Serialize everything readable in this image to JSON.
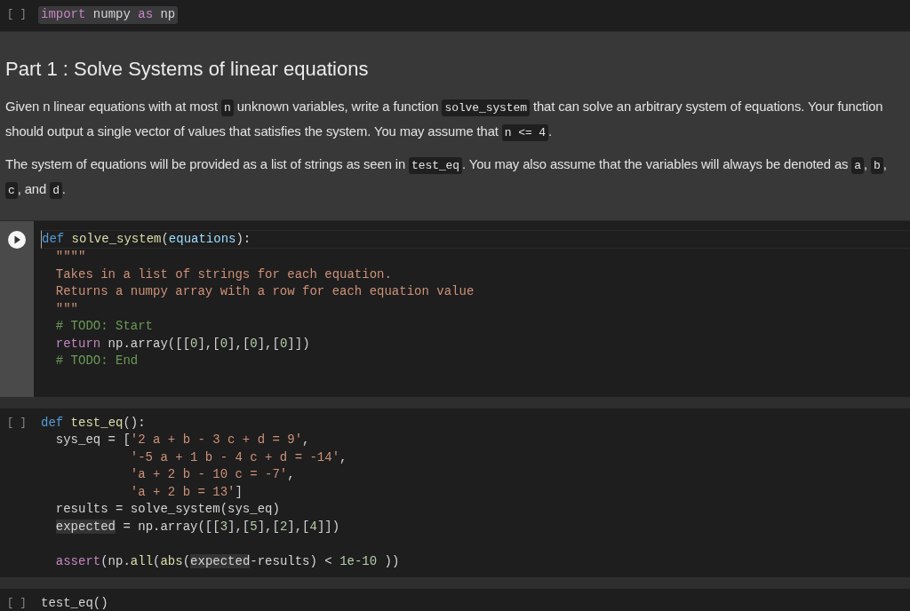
{
  "cells": [
    {
      "kind": "code",
      "prompt": "[ ]",
      "selected": false,
      "lines": [
        {
          "highlighted": true,
          "tokens": [
            {
              "t": "import",
              "kind": "kw2"
            },
            {
              "t": " numpy ",
              "kind": "plain"
            },
            {
              "t": "as",
              "kind": "kw2"
            },
            {
              "t": " np",
              "kind": "plain"
            }
          ]
        }
      ]
    },
    {
      "kind": "markdown",
      "heading": "Part 1 : Solve Systems of linear equations",
      "paragraphs": [
        [
          {
            "t": "Given n linear equations with at most ",
            "code": false
          },
          {
            "t": "n",
            "code": true
          },
          {
            "t": " unknown variables, write a function ",
            "code": false
          },
          {
            "t": "solve_system",
            "code": true
          },
          {
            "t": " that can solve an arbitrary system of equations. Your function should output a single vector of values that satisfies the system. You may assume that ",
            "code": false
          },
          {
            "t": "n <= 4",
            "code": true
          },
          {
            "t": ".",
            "code": false
          }
        ],
        [
          {
            "t": "The system of equations will be provided as a list of strings as seen in ",
            "code": false
          },
          {
            "t": "test_eq",
            "code": true
          },
          {
            "t": ". You may also assume that the variables will always be denoted as ",
            "code": false
          },
          {
            "t": "a",
            "code": true
          },
          {
            "t": ", ",
            "code": false
          },
          {
            "t": "b",
            "code": true
          },
          {
            "t": ", ",
            "code": false
          },
          {
            "t": "c",
            "code": true
          },
          {
            "t": ", and ",
            "code": false
          },
          {
            "t": "d",
            "code": true
          },
          {
            "t": ".",
            "code": false
          }
        ]
      ]
    },
    {
      "kind": "code",
      "selected": true,
      "lines": [
        {
          "highlighted": false,
          "tokens": [
            {
              "t": "def",
              "kind": "kw"
            },
            {
              "t": " solve_system",
              "kind": "fn"
            },
            {
              "t": "(",
              "kind": "plain"
            },
            {
              "t": "equations",
              "kind": "param"
            },
            {
              "t": "):",
              "kind": "plain"
            }
          ]
        },
        {
          "highlighted": false,
          "tokens": [
            {
              "t": "  \"\"\"\"",
              "kind": "str"
            }
          ]
        },
        {
          "highlighted": false,
          "tokens": [
            {
              "t": "  Takes in a list of strings for each equation.",
              "kind": "str"
            }
          ]
        },
        {
          "highlighted": false,
          "tokens": [
            {
              "t": "  Returns a numpy array with a row for each equation value",
              "kind": "str"
            }
          ]
        },
        {
          "highlighted": false,
          "tokens": [
            {
              "t": "  \"\"\"",
              "kind": "str"
            }
          ]
        },
        {
          "highlighted": false,
          "tokens": [
            {
              "t": "  # TODO: Start",
              "kind": "com"
            }
          ]
        },
        {
          "highlighted": false,
          "tokens": [
            {
              "t": "  return",
              "kind": "kw2"
            },
            {
              "t": " np.array([[",
              "kind": "plain"
            },
            {
              "t": "0",
              "kind": "num"
            },
            {
              "t": "],[",
              "kind": "plain"
            },
            {
              "t": "0",
              "kind": "num"
            },
            {
              "t": "],[",
              "kind": "plain"
            },
            {
              "t": "0",
              "kind": "num"
            },
            {
              "t": "],[",
              "kind": "plain"
            },
            {
              "t": "0",
              "kind": "num"
            },
            {
              "t": "]])",
              "kind": "plain"
            }
          ]
        },
        {
          "highlighted": false,
          "tokens": [
            {
              "t": "  # TODO: End",
              "kind": "com"
            }
          ]
        }
      ]
    },
    {
      "kind": "code",
      "prompt": "[ ]",
      "selected": false,
      "lines": [
        {
          "highlighted": false,
          "tokens": [
            {
              "t": "def",
              "kind": "kw"
            },
            {
              "t": " test_eq",
              "kind": "fn"
            },
            {
              "t": "():",
              "kind": "plain"
            }
          ]
        },
        {
          "highlighted": false,
          "tokens": [
            {
              "t": "  sys_eq = [",
              "kind": "plain"
            },
            {
              "t": "'2 a + b - 3 c + d = 9'",
              "kind": "str"
            },
            {
              "t": ",",
              "kind": "plain"
            }
          ]
        },
        {
          "highlighted": false,
          "tokens": [
            {
              "t": "            '-5 a + 1 b - 4 c + d = -14'",
              "kind": "str"
            },
            {
              "t": ",",
              "kind": "plain"
            }
          ]
        },
        {
          "highlighted": false,
          "tokens": [
            {
              "t": "            'a + 2 b - 10 c = -7'",
              "kind": "str"
            },
            {
              "t": ",",
              "kind": "plain"
            }
          ]
        },
        {
          "highlighted": false,
          "tokens": [
            {
              "t": "            'a + 2 b = 13'",
              "kind": "str"
            },
            {
              "t": "]",
              "kind": "plain"
            }
          ]
        },
        {
          "highlighted": false,
          "tokens": [
            {
              "t": "  results = solve_system(sys_eq)",
              "kind": "plain"
            }
          ]
        },
        {
          "highlighted": false,
          "tokens": [
            {
              "t": "  expected",
              "kind": "hl"
            },
            {
              "t": " = np.array([[",
              "kind": "plain"
            },
            {
              "t": "3",
              "kind": "num"
            },
            {
              "t": "],[",
              "kind": "plain"
            },
            {
              "t": "5",
              "kind": "num"
            },
            {
              "t": "],[",
              "kind": "plain"
            },
            {
              "t": "2",
              "kind": "num"
            },
            {
              "t": "],[",
              "kind": "plain"
            },
            {
              "t": "4",
              "kind": "num"
            },
            {
              "t": "]])",
              "kind": "plain"
            }
          ]
        },
        {
          "highlighted": false,
          "blank_before": true,
          "tokens": [
            {
              "t": "  assert",
              "kind": "kw2"
            },
            {
              "t": "(np.",
              "kind": "plain"
            },
            {
              "t": "all",
              "kind": "fn"
            },
            {
              "t": "(",
              "kind": "plain"
            },
            {
              "t": "abs",
              "kind": "fn"
            },
            {
              "t": "(",
              "kind": "plain"
            },
            {
              "t": "expected",
              "kind": "hl"
            },
            {
              "t": "-results) < ",
              "kind": "plain"
            },
            {
              "t": "1e-10",
              "kind": "num"
            },
            {
              "t": " ))",
              "kind": "plain"
            }
          ]
        }
      ]
    },
    {
      "kind": "code",
      "prompt": "[ ]",
      "selected": false,
      "lines": [
        {
          "highlighted": false,
          "tokens": [
            {
              "t": "test_eq()",
              "kind": "plain"
            }
          ]
        }
      ]
    }
  ]
}
